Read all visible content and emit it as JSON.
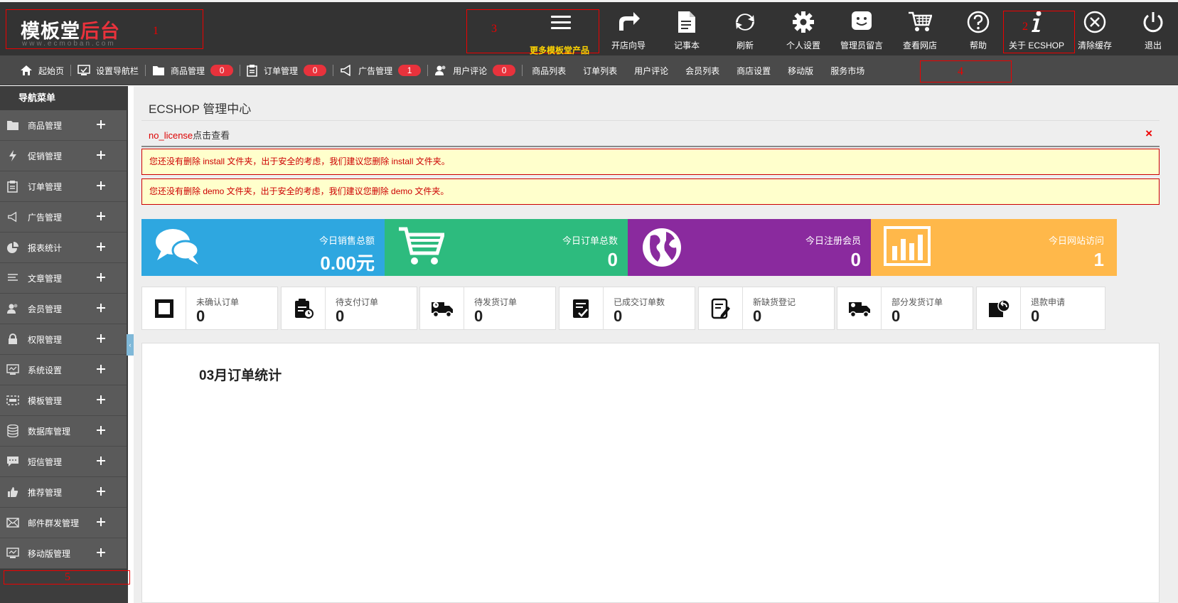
{
  "header": {
    "logo_main_a": "模板堂",
    "logo_main_b": "后台",
    "logo_sub": "www.ecmoban.com",
    "annot_1": "1",
    "annot_2": "2",
    "annot_3": "3",
    "more_products": "更多模板堂产品",
    "tools": [
      {
        "label": "开店向导",
        "icon": "share-arrow-icon"
      },
      {
        "label": "记事本",
        "icon": "notepad-icon"
      },
      {
        "label": "刷新",
        "icon": "refresh-icon"
      },
      {
        "label": "个人设置",
        "icon": "gear-icon"
      },
      {
        "label": "管理员留言",
        "icon": "message-smile-icon"
      },
      {
        "label": "查看网店",
        "icon": "cart-icon"
      },
      {
        "label": "帮助",
        "icon": "help-icon"
      },
      {
        "label": "关于 ECSHOP",
        "icon": "info-icon"
      },
      {
        "label": "清除缓存",
        "icon": "close-circle-icon"
      },
      {
        "label": "退出",
        "icon": "power-icon"
      }
    ]
  },
  "subnav": {
    "annot_4": "4",
    "items": [
      {
        "label": "起始页"
      },
      {
        "label": "设置导航栏"
      },
      {
        "label": "商品管理",
        "badge": "0"
      },
      {
        "label": "订单管理",
        "badge": "0"
      },
      {
        "label": "广告管理",
        "badge": "1"
      },
      {
        "label": "用户评论",
        "badge": "0"
      }
    ],
    "links": [
      "商品列表",
      "订单列表",
      "用户评论",
      "会员列表",
      "商店设置",
      "移动版",
      "服务市场"
    ]
  },
  "sidebar": {
    "title": "导航菜单",
    "annot_5": "5",
    "collapse": "‹",
    "items": [
      {
        "label": "商品管理"
      },
      {
        "label": "促销管理"
      },
      {
        "label": "订单管理"
      },
      {
        "label": "广告管理"
      },
      {
        "label": "报表统计"
      },
      {
        "label": "文章管理"
      },
      {
        "label": "会员管理"
      },
      {
        "label": "权限管理"
      },
      {
        "label": "系统设置"
      },
      {
        "label": "模板管理"
      },
      {
        "label": "数据库管理"
      },
      {
        "label": "短信管理"
      },
      {
        "label": "推荐管理"
      },
      {
        "label": "邮件群发管理"
      },
      {
        "label": "移动版管理"
      }
    ]
  },
  "main": {
    "title": "ECSHOP 管理中心",
    "license_red": "no_license",
    "license_dark": "点击查看",
    "close_glyph": "×",
    "warnings": [
      "您还没有删除 install 文件夹，出于安全的考虑，我们建议您删除 install 文件夹。",
      "您还没有删除 demo 文件夹，出于安全的考虑，我们建议您删除 demo 文件夹。"
    ],
    "stats": [
      {
        "label": "今日销售总额",
        "value": "0.00元",
        "color": "#2ea7e0"
      },
      {
        "label": "今日订单总数",
        "value": "0",
        "color": "#2dbb7e"
      },
      {
        "label": "今日注册会员",
        "value": "0",
        "color": "#8a2a9e"
      },
      {
        "label": "今日网站访问",
        "value": "1",
        "color": "#ffb84a"
      }
    ],
    "minis": [
      {
        "label": "未确认订单",
        "value": "0"
      },
      {
        "label": "待支付订单",
        "value": "0"
      },
      {
        "label": "待发货订单",
        "value": "0"
      },
      {
        "label": "已成交订单数",
        "value": "0"
      },
      {
        "label": "新缺货登记",
        "value": "0"
      },
      {
        "label": "部分发货订单",
        "value": "0"
      },
      {
        "label": "退款申请",
        "value": "0"
      }
    ],
    "chart_title": "03月订单统计"
  }
}
